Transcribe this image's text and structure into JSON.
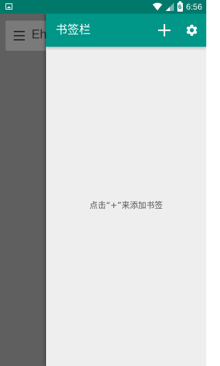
{
  "status_bar": {
    "time": "6:56",
    "battery_level": "6",
    "icons": [
      "image-icon",
      "wifi-icon",
      "signal-icon",
      "battery-charging-icon"
    ]
  },
  "background_app": {
    "title": "Eh",
    "menu_icon": "hamburger-menu-icon"
  },
  "drawer": {
    "title": "书签栏",
    "add_icon": "plus-icon",
    "settings_icon": "gear-icon",
    "empty_hint": "点击“+”来添加书签"
  },
  "colors": {
    "status_bar": "#00796b",
    "drawer_header": "#009688",
    "drawer_background": "#eeeeee",
    "scrim": "#5f5f5f"
  }
}
